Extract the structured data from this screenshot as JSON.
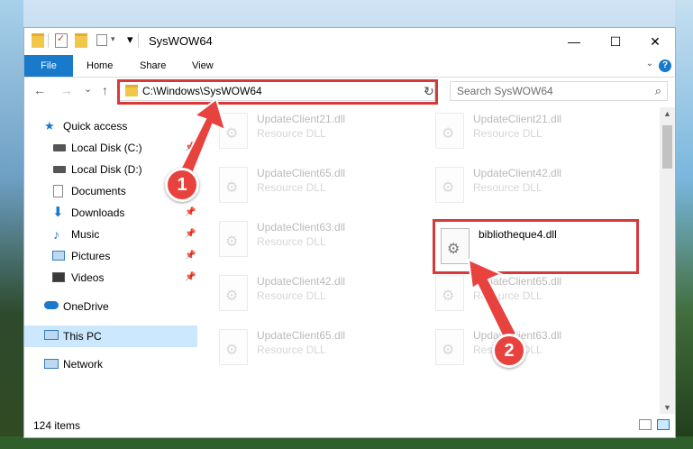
{
  "window": {
    "title": "SysWOW64",
    "minimize_glyph": "—",
    "maximize_glyph": "☐",
    "close_glyph": "✕"
  },
  "ribbon": {
    "file_tab": "File",
    "tabs": [
      "Home",
      "Share",
      "View"
    ],
    "help_glyph": "?"
  },
  "navigation": {
    "back_glyph": "←",
    "forward_glyph": "→",
    "recent_glyph": "⌄",
    "up_glyph": "↑",
    "address": "C:\\Windows\\SysWOW64",
    "refresh_glyph": "↻",
    "search_placeholder": "Search SysWOW64",
    "search_glyph": "⌕"
  },
  "sidebar": {
    "items": [
      {
        "label": "Quick access",
        "icon": "star-icon",
        "pinned": false
      },
      {
        "label": "Local Disk (C:)",
        "icon": "drive-icon",
        "pinned": true
      },
      {
        "label": "Local Disk (D:)",
        "icon": "drive-icon",
        "pinned": false
      },
      {
        "label": "Documents",
        "icon": "documents-icon",
        "pinned": true
      },
      {
        "label": "Downloads",
        "icon": "downloads-icon",
        "pinned": true
      },
      {
        "label": "Music",
        "icon": "music-icon",
        "pinned": true
      },
      {
        "label": "Pictures",
        "icon": "pictures-icon",
        "pinned": true
      },
      {
        "label": "Videos",
        "icon": "videos-icon",
        "pinned": true
      },
      {
        "label": "OneDrive",
        "icon": "cloud-icon",
        "pinned": false
      },
      {
        "label": "This PC",
        "icon": "computer-icon",
        "pinned": false,
        "selected": true
      },
      {
        "label": "Network",
        "icon": "network-icon",
        "pinned": false
      }
    ],
    "pin_glyph": "📌"
  },
  "files": [
    {
      "name": "UpdateClient21.dll",
      "type": "Resource DLL",
      "faded": true
    },
    {
      "name": "UpdateClient21.dll",
      "type": "Resource DLL",
      "faded": true
    },
    {
      "name": "UpdateClient65.dll",
      "type": "Resource DLL",
      "faded": true
    },
    {
      "name": "UpdateClient42.dll",
      "type": "Resource DLL",
      "faded": true
    },
    {
      "name": "UpdateClient63.dll",
      "type": "Resource DLL",
      "faded": true
    },
    {
      "name": "bibliotheque4.dll",
      "type": "",
      "faded": false
    },
    {
      "name": "UpdateClient42.dll",
      "type": "Resource DLL",
      "faded": true
    },
    {
      "name": "UpdateClient65.dll",
      "type": "Resource DLL",
      "faded": true
    },
    {
      "name": "UpdateClient65.dll",
      "type": "Resource DLL",
      "faded": true
    },
    {
      "name": "UpdateClient63.dll",
      "type": "Resource DLL",
      "faded": true
    }
  ],
  "status": {
    "item_count": "124 items"
  },
  "annotations": {
    "callout_1": "1",
    "callout_2": "2",
    "highlight_color": "#d9383a"
  }
}
